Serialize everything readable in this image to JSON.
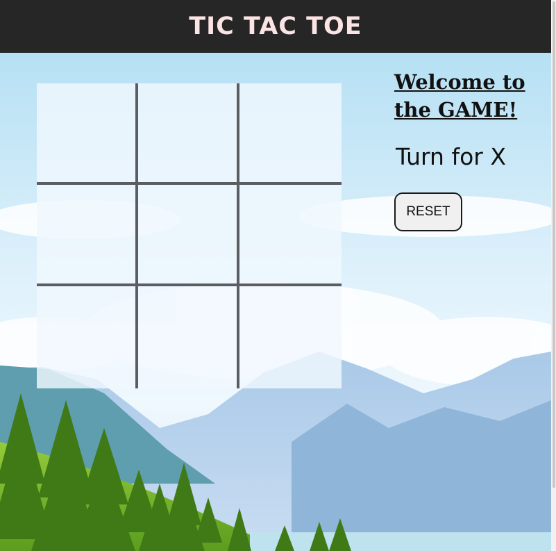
{
  "header": {
    "title": "TIC TAC TOE"
  },
  "board": {
    "cells": [
      "",
      "",
      "",
      "",
      "",
      "",
      "",
      "",
      ""
    ]
  },
  "info": {
    "welcome": "Welcome to\nthe GAME!",
    "turn": "Turn for X",
    "reset_label": "RESET"
  },
  "colors": {
    "header_bg": "#262626",
    "title_color": "#fde4e4",
    "grid_line": "#5a5e63",
    "sky_top": "#b8e1f5",
    "mountain": "#9fc3e4",
    "tree": "#3f7a16",
    "grass": "#86c232"
  }
}
